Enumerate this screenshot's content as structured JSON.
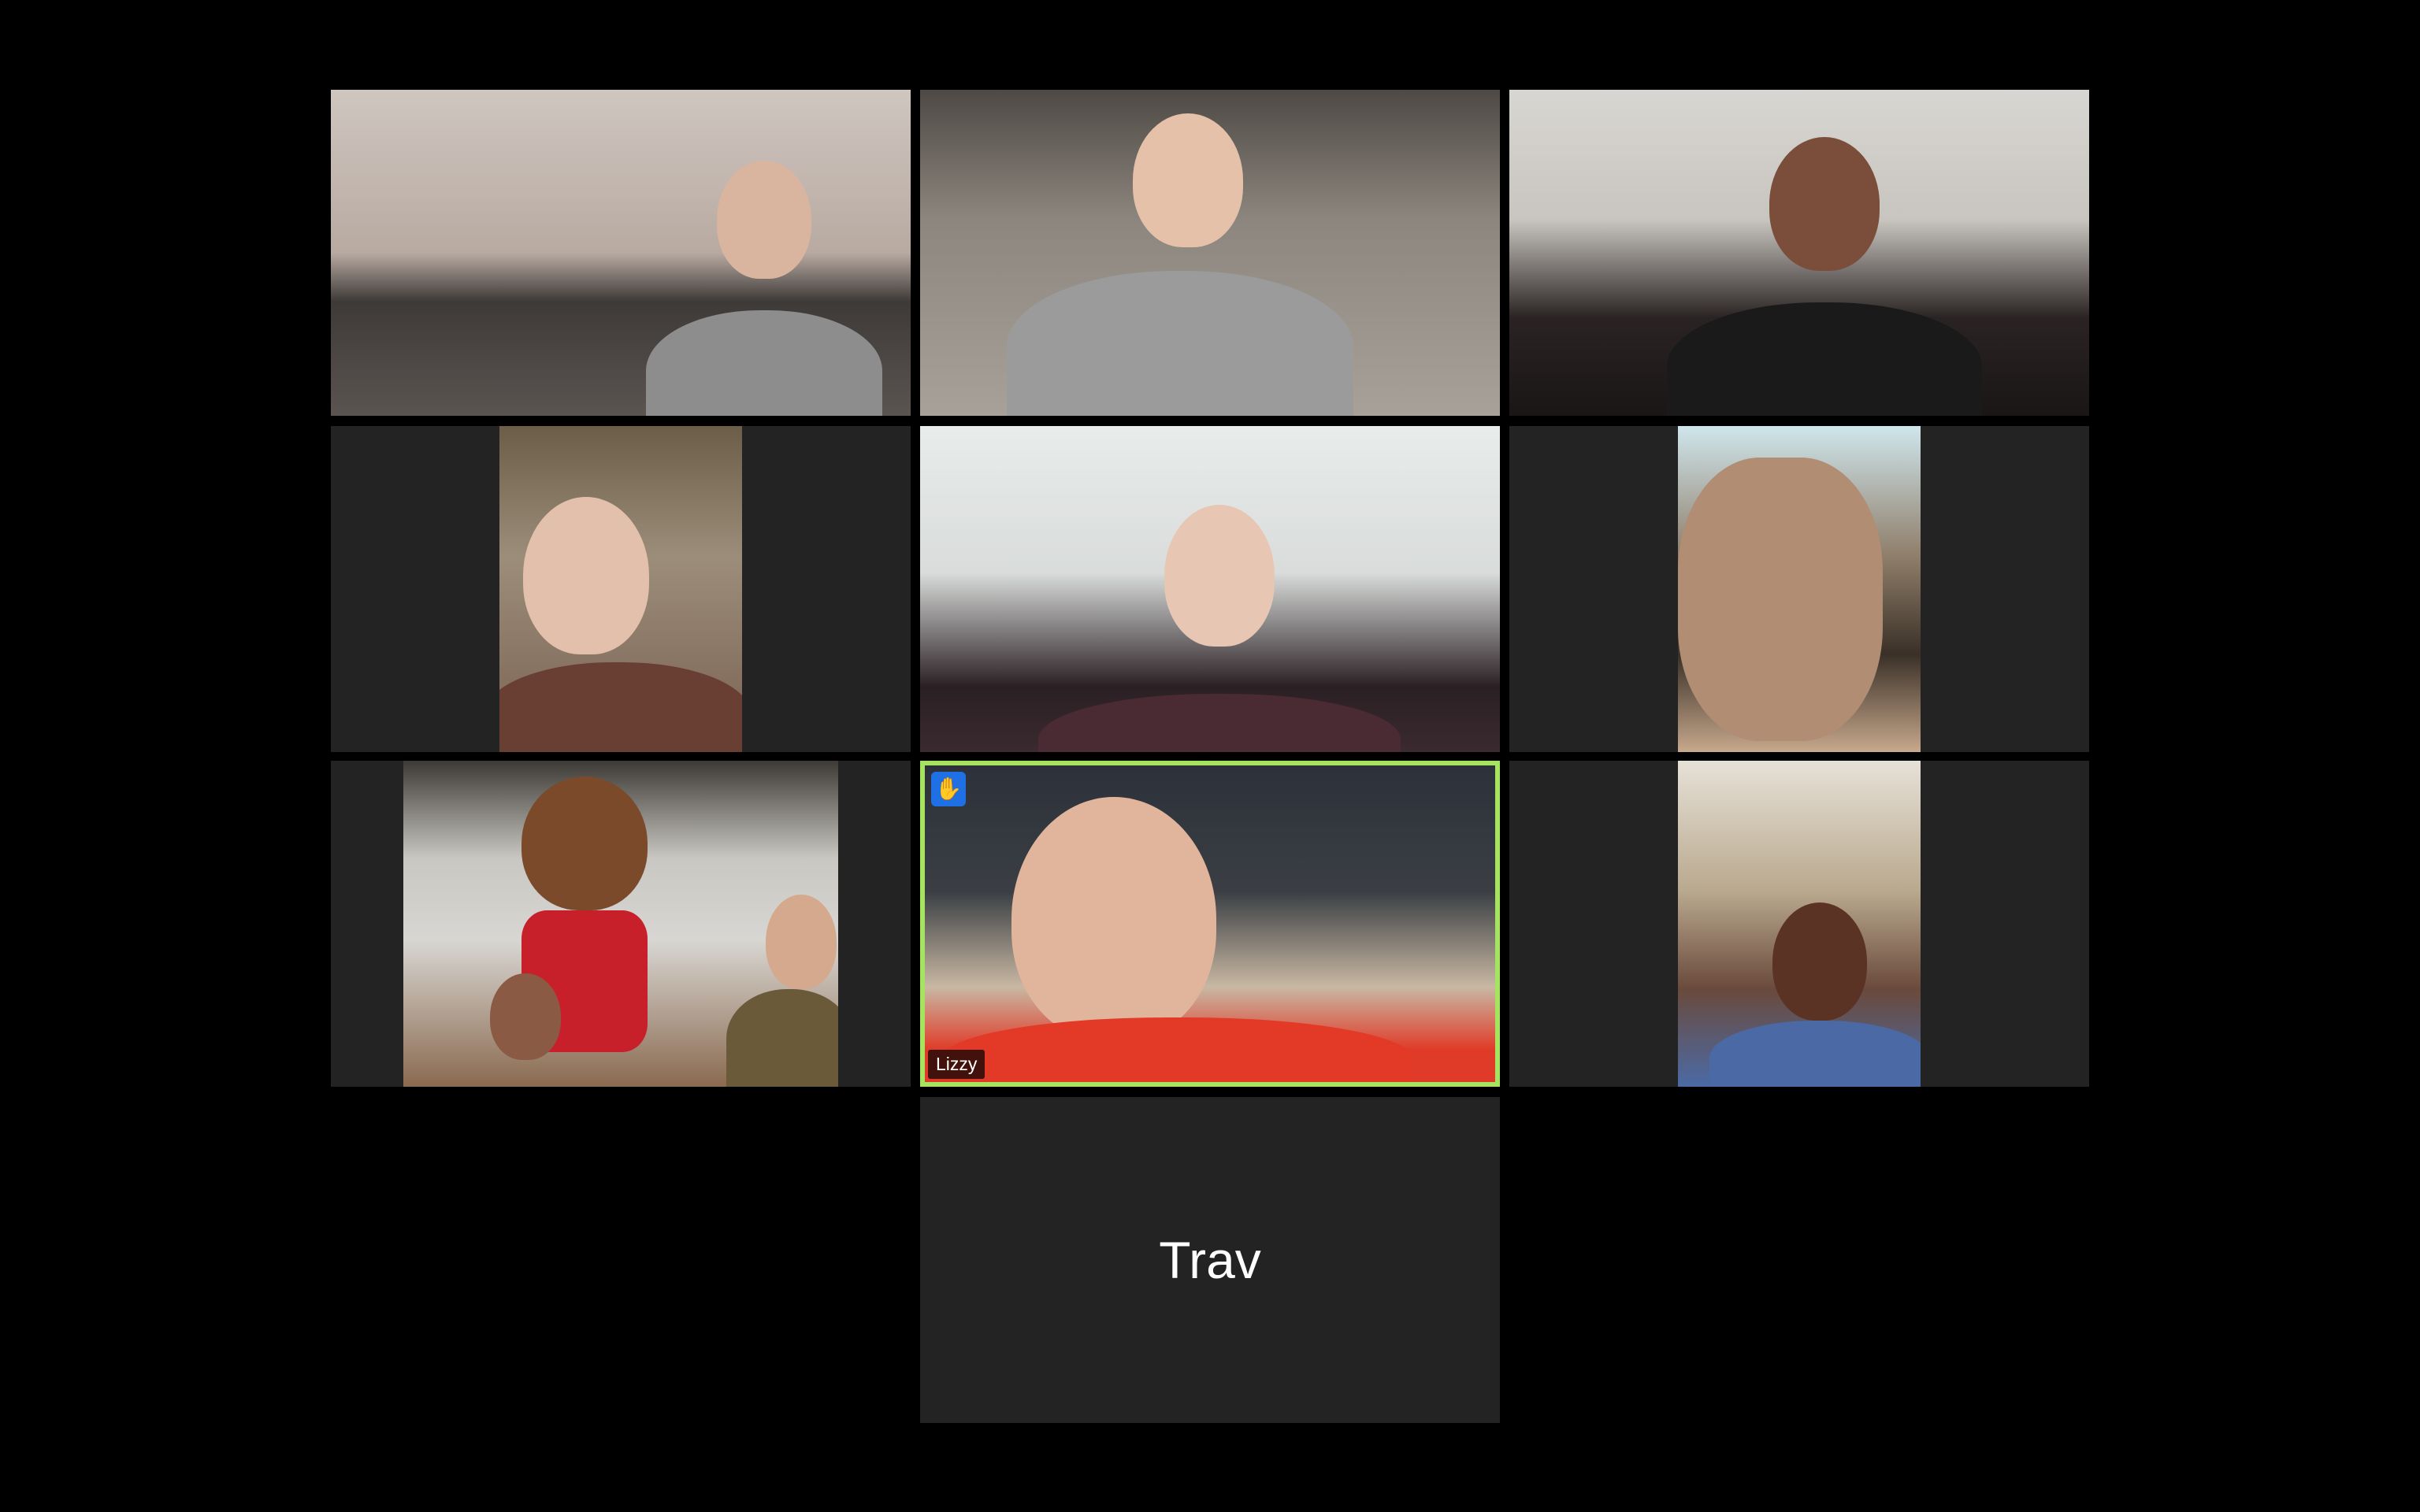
{
  "meeting": {
    "layout": "gallery-view",
    "colors": {
      "background": "#000000",
      "tile_background": "#232323",
      "active_speaker_border": "#a6e35f",
      "raise_hand_badge": "#1f6fe5"
    }
  },
  "participants": [
    {
      "video": "on",
      "name_shown": ""
    },
    {
      "video": "on",
      "name_shown": ""
    },
    {
      "video": "on",
      "name_shown": ""
    },
    {
      "video": "on",
      "name_shown": ""
    },
    {
      "video": "on",
      "name_shown": ""
    },
    {
      "video": "on",
      "name_shown": ""
    },
    {
      "video": "on",
      "name_shown": ""
    },
    {
      "video": "on",
      "name": "Lizzy",
      "active_speaker": true,
      "hand_raised": true,
      "hand_icon": "raised-hand-icon"
    },
    {
      "video": "on",
      "name_shown": ""
    },
    {
      "video": "off",
      "name": "Trav"
    }
  ]
}
